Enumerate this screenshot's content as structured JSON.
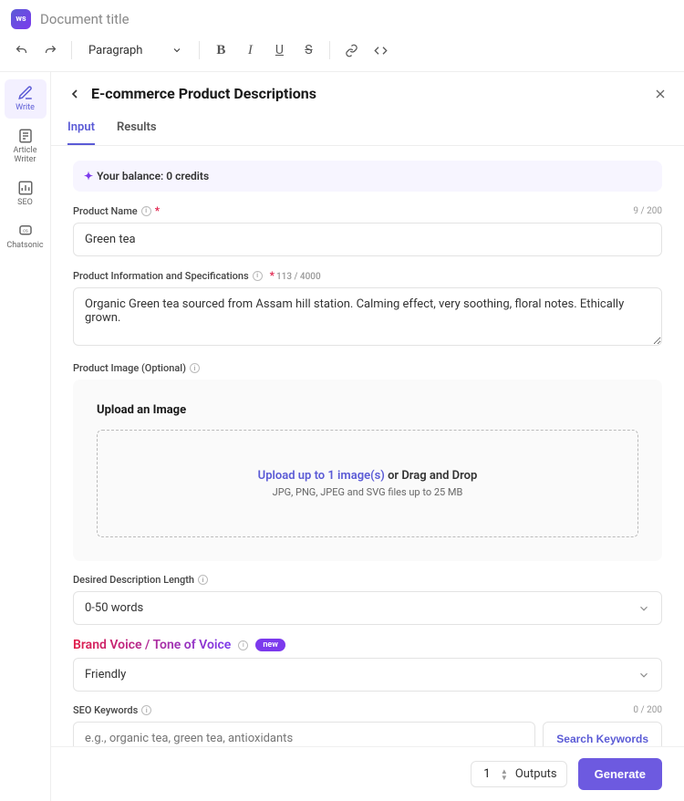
{
  "logo_text": "ws",
  "doc_title": "Document title",
  "toolbar": {
    "style_select": "Paragraph"
  },
  "sidebar": {
    "items": [
      {
        "label": "Write"
      },
      {
        "label": "Article Writer"
      },
      {
        "label": "SEO"
      },
      {
        "label": "Chatsonic"
      }
    ]
  },
  "panel": {
    "title": "E-commerce Product Descriptions",
    "tabs": [
      "Input",
      "Results"
    ],
    "balance": "Your balance: 0 credits"
  },
  "fields": {
    "product_name": {
      "label": "Product Name",
      "value": "Green tea",
      "counter": "9 / 200"
    },
    "product_info": {
      "label": "Product Information and Specifications",
      "value": "Organic Green tea sourced from Assam hill station. Calming effect, very soothing, floral notes. Ethically grown.",
      "counter": "113 / 4000"
    },
    "product_image": {
      "label": "Product Image (Optional)",
      "upload_heading": "Upload an Image",
      "dz_link": "Upload up to 1 image(s)",
      "dz_rest": " or Drag and Drop",
      "dz_sub": "JPG, PNG, JPEG and SVG files up to 25 MB"
    },
    "desired_length": {
      "label": "Desired Description Length",
      "value": "0-50 words"
    },
    "brand_voice": {
      "label": "Brand Voice / Tone of Voice",
      "badge": "new",
      "value": "Friendly"
    },
    "seo": {
      "label": "SEO Keywords",
      "counter": "0 / 200",
      "placeholder": "e.g., organic tea, green tea, antioxidants",
      "search_btn": "Search Keywords"
    }
  },
  "footer": {
    "outputs_num": "1",
    "outputs_label": "Outputs",
    "generate": "Generate"
  }
}
